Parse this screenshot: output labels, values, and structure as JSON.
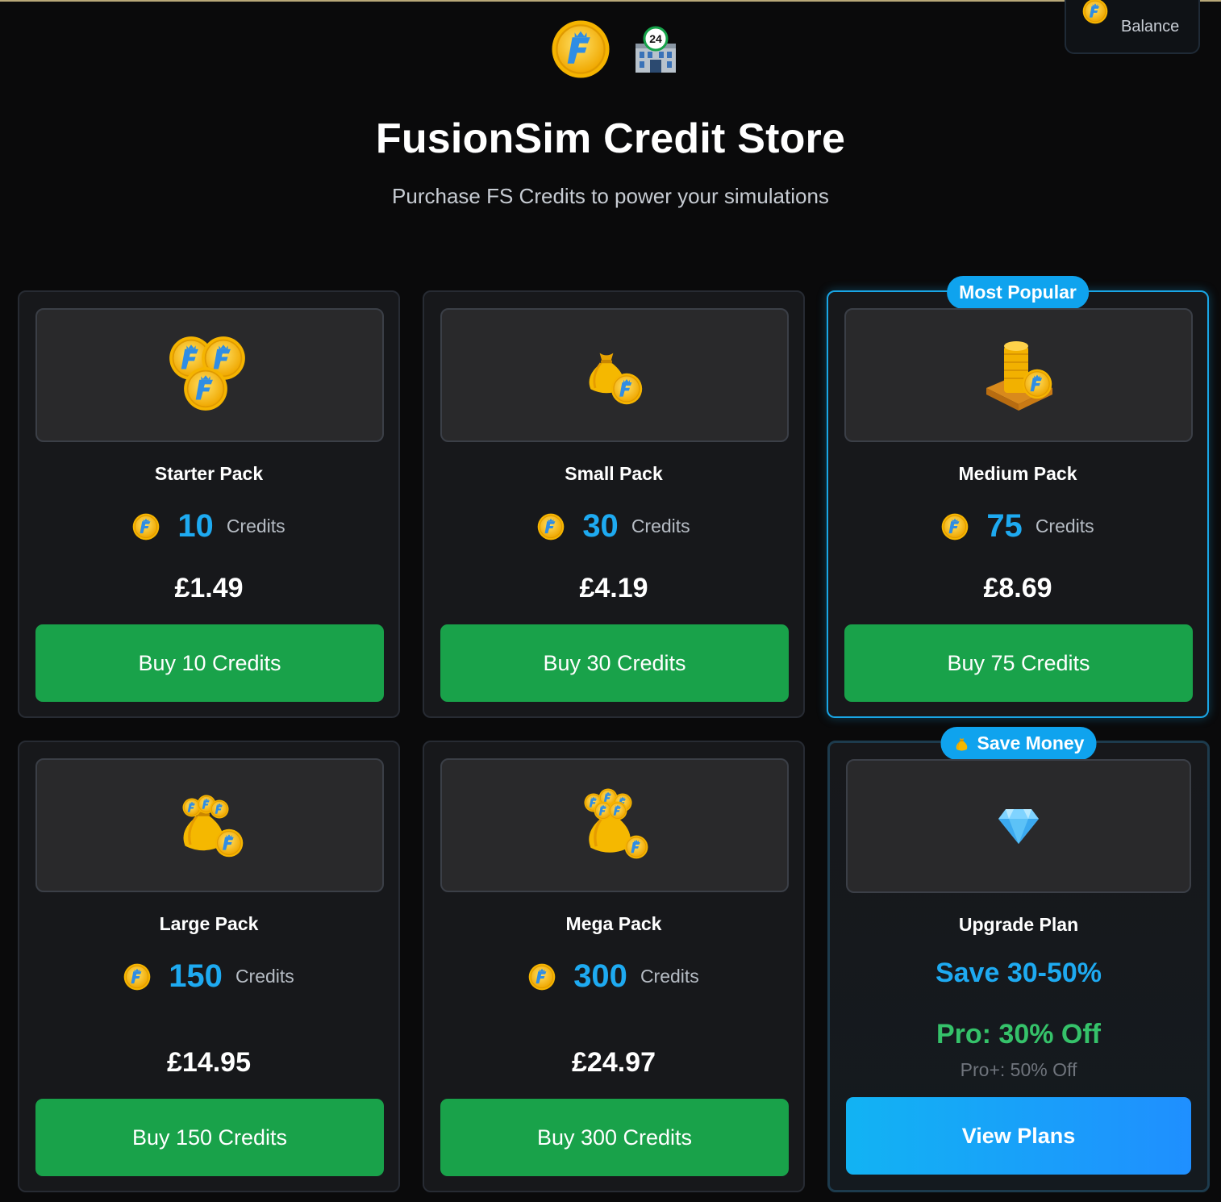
{
  "app": {
    "title": "FusionSim Credit Store",
    "subtitle": "Purchase FS Credits to power your simulations"
  },
  "balance": {
    "label": "Balance"
  },
  "icons": {
    "logo": "fs-coin-icon",
    "building": "building-24-icon",
    "credit": "coin-icon"
  },
  "colors": {
    "accent": "#1eaaf1",
    "buy": "#19a24a",
    "pro": "#35c26a",
    "badge": "#0fa3ee"
  },
  "packs": [
    {
      "name": "Starter Pack",
      "credits": "10",
      "credits_label": "Credits",
      "price": "£1.49",
      "button": "Buy 10 Credits"
    },
    {
      "name": "Small Pack",
      "credits": "30",
      "credits_label": "Credits",
      "price": "£4.19",
      "button": "Buy 30 Credits"
    },
    {
      "name": "Medium Pack",
      "credits": "75",
      "credits_label": "Credits",
      "price": "£8.69",
      "button": "Buy 75 Credits",
      "badge": "Most Popular"
    },
    {
      "name": "Large Pack",
      "credits": "150",
      "credits_label": "Credits",
      "price": "£14.95",
      "button": "Buy 150 Credits"
    },
    {
      "name": "Mega Pack",
      "credits": "300",
      "credits_label": "Credits",
      "price": "£24.97",
      "button": "Buy 300 Credits"
    }
  ],
  "upgrade": {
    "badge": "Save Money",
    "title": "Upgrade Plan",
    "save": "Save 30-50%",
    "pro": "Pro: 30% Off",
    "pro_plus": "Pro+: 50% Off",
    "button": "View Plans"
  }
}
